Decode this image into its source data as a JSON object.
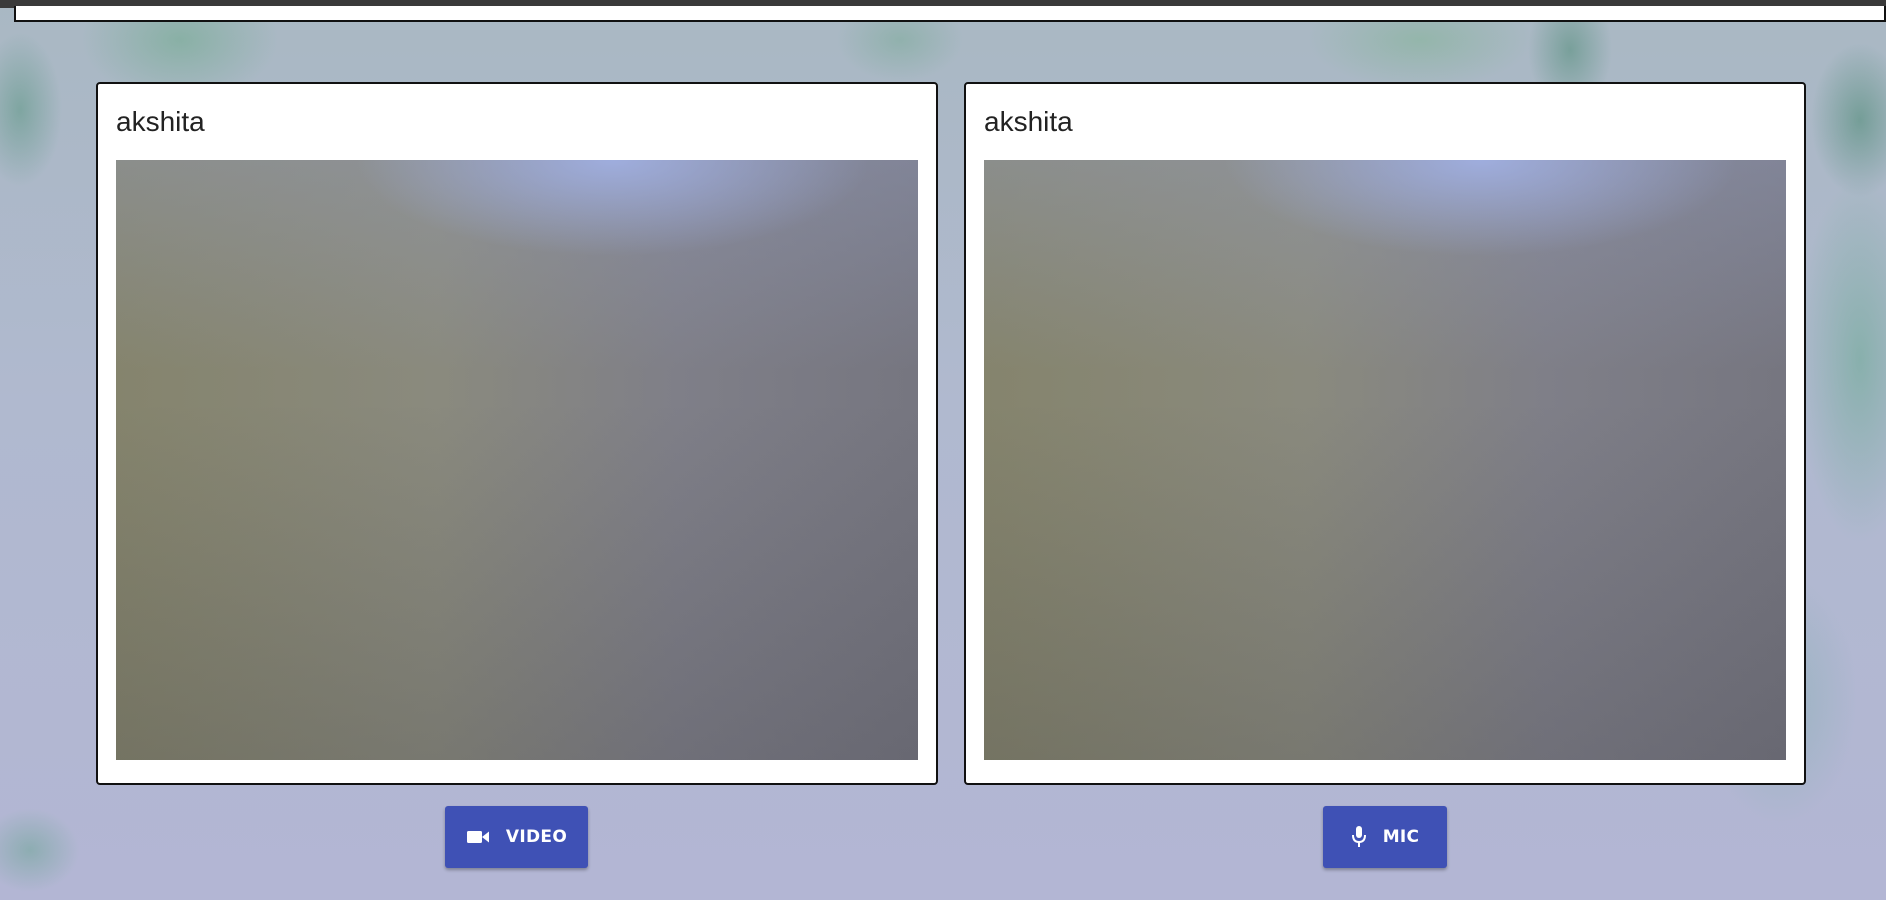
{
  "participants": [
    {
      "name": "akshita"
    },
    {
      "name": "akshita"
    }
  ],
  "controls": {
    "video_label": "VIDEO",
    "mic_label": "MIC",
    "video_icon": "videocam-icon",
    "mic_icon": "mic-icon"
  },
  "colors": {
    "button_bg": "#3f51b5",
    "button_text": "#ffffff",
    "card_bg": "#ffffff"
  }
}
